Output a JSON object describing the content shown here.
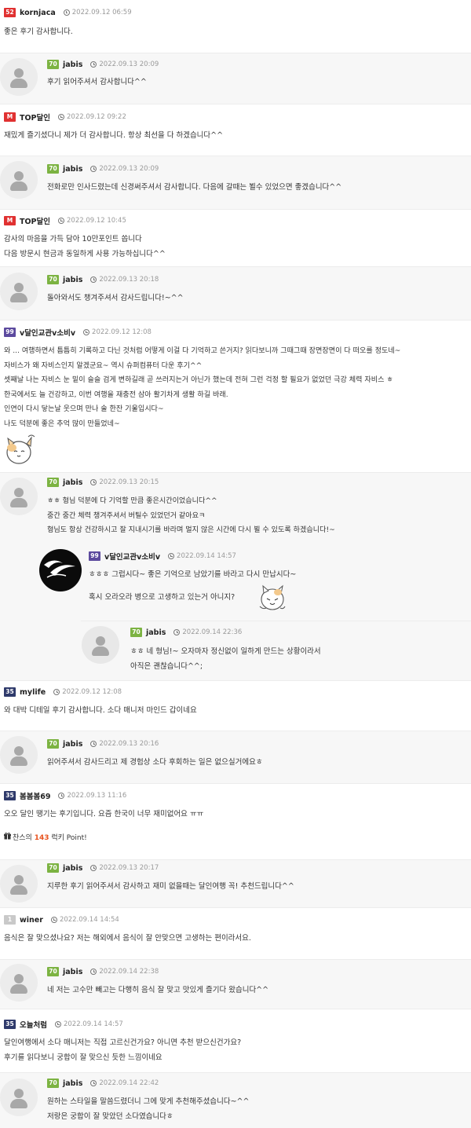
{
  "colors": {
    "red_badge": "#e03131",
    "green_badge": "#7cb342",
    "purple_badge": "#5c4a9e",
    "navy_badge": "#2f3a6b",
    "gray_badge": "#c9c9c9",
    "luck_number": "#e8531f"
  },
  "icons": {
    "time": "clock-icon",
    "avatar": "user-silhouette-icon",
    "gift": "gift-icon"
  },
  "comments": [
    {
      "badge": "52",
      "nick": "kornjaca",
      "date": "2022.09.12 06:59",
      "lines": [
        "좋은 후기 감사합니다."
      ]
    },
    {
      "badge": "70",
      "nick": "jabis",
      "date": "2022.09.13 20:09",
      "lines": [
        "후기 읽어주셔서 감사합니다^^"
      ]
    },
    {
      "badge": "M",
      "nick": "TOP달인",
      "date": "2022.09.12 09:22",
      "lines": [
        "재밌게 즐기셨다니 제가 더 감사합니다. 항상 최선을 다 하겠습니다^^"
      ]
    },
    {
      "badge": "70",
      "nick": "jabis",
      "date": "2022.09.13 20:09",
      "lines": [
        "전화로만 인사드렸는데 신경써주셔서 감사합니다. 다음에 갈때는 뵐수 있었으면 좋겠습니다^^"
      ]
    },
    {
      "badge": "M",
      "nick": "TOP달인",
      "date": "2022.09.12 10:45",
      "lines": [
        "감사의 마음을 가득 담아 10만포인트 쏩니다",
        "다음 방문시 현금과 동일하게 사용 가능하십니다^^"
      ]
    },
    {
      "badge": "70",
      "nick": "jabis",
      "date": "2022.09.13 20:18",
      "lines": [
        "돌아와서도 챙겨주셔서 감사드립니다!~^^"
      ]
    },
    {
      "badge": "99",
      "nick": "v달인교관v소비v",
      "date": "2022.09.12 12:08",
      "lines": [
        "와 ... 여행하면서 틈틈히 기록하고 다닌 것처럼 어떻게 이걸 다 기억하고 쓴거지? 읽다보니까 그때그때 장면장면이 다 떠오를 정도네~",
        "자비스가 왜 자비스인지 알겠군요~ 역시 슈퍼컴퓨터 다운 후기^^",
        "셋째날 나는 자비스 눈 밑이 슬슬 검게 변하길래 곧 쓰러지는거 아닌가 했는데 전혀 그런 걱정 할 필요가 없었던 극강 체력 자비스 ㅎ",
        "한국에서도 늘 건강하고, 이번 여행을 재충전 삼아 활기차게 생활 하길 바래.",
        "인연이 다시 닿는날 웃으며 만나 술 한잔 기울입시다~",
        "나도 덕분에 좋은 추억 많이 만들었네~"
      ]
    },
    {
      "badge": "70",
      "nick": "jabis",
      "date": "2022.09.13 20:15",
      "lines": [
        "ㅎㅎ 형님 덕분에 다 기억할 만큼 좋은시간이었습니다^^",
        "중간 중간 체력 챙겨주셔서 버틸수 있었던거 같아요ㅋ",
        "형님도 항상 건강하시고 잘 지내시기를 바라며 멀지 않은 시간에 다시 뵐 수 있도록 하겠습니다!~"
      ]
    },
    {
      "badge": "99",
      "nick": "v달인교관v소비v",
      "date": "2022.09.14 14:57",
      "lines": [
        "ㅎㅎㅎ 그럽시다~ 좋은 기억으로 남았기를 바라고 다시 만납시다~",
        "혹시 오라오라 병으로 고생하고 있는거 아니지?"
      ]
    },
    {
      "badge": "70",
      "nick": "jabis",
      "date": "2022.09.14 22:36",
      "lines": [
        "ㅎㅎ 네 형님!~ 오자마자 정신없이 일하게 만드는 상황이라서",
        "아직은 괜찮습니다^^;"
      ]
    },
    {
      "badge": "35",
      "nick": "mylife",
      "date": "2022.09.12 12:08",
      "lines": [
        "와 대박 디테일 후기 감사합니다. 소다 매니저 마인드 갑이네요"
      ]
    },
    {
      "badge": "70",
      "nick": "jabis",
      "date": "2022.09.13 20:16",
      "lines": [
        "읽어주셔서 감사드리고 제 경험상 소다 후회하는 일은 없으실거에요ㅎ"
      ]
    },
    {
      "badge": "35",
      "nick": "봄봄봄69",
      "date": "2022.09.13 11:16",
      "lines": [
        "오오 달인 땡기는 후기입니다. 요즘 한국이 너무 재미없어요 ㅠㅠ"
      ],
      "luck": {
        "prefix": "찬스의",
        "number": "143",
        "suffix": "럭키 Point!"
      }
    },
    {
      "badge": "70",
      "nick": "jabis",
      "date": "2022.09.13 20:17",
      "lines": [
        "지루한 후기 읽어주셔서 감사하고 재미 없을때는 달인여행 꼭! 추천드립니다^^"
      ]
    },
    {
      "badge": "1",
      "nick": "winer",
      "date": "2022.09.14 14:54",
      "lines": [
        "음식은 잘 맞으셨나요? 저는 해외에서 음식이 잘 안맞으면 고생하는 편이라서요."
      ]
    },
    {
      "badge": "70",
      "nick": "jabis",
      "date": "2022.09.14 22:38",
      "lines": [
        "네 저는 고수만 빼고는 다행히 음식 잘 맞고 맛있게 즐기다 왔습니다^^"
      ]
    },
    {
      "badge": "35",
      "nick": "오늘처럼",
      "date": "2022.09.14 14:57",
      "lines": [
        "달인여행에서 소다 매니저는 직접 고르신건가요? 아니면 추천 받으신건가요?",
        "후기를 읽다보니 궁합이 잘 맞으신 듯한 느낌이네요"
      ]
    },
    {
      "badge": "70",
      "nick": "jabis",
      "date": "2022.09.14 22:42",
      "lines": [
        "원하는 스타일을 말씀드렸더니 그에 맞게 추천해주셨습니다~^^",
        "저랑은 궁합이 잘 맞았던 소다였습니다ㅎ"
      ]
    }
  ]
}
